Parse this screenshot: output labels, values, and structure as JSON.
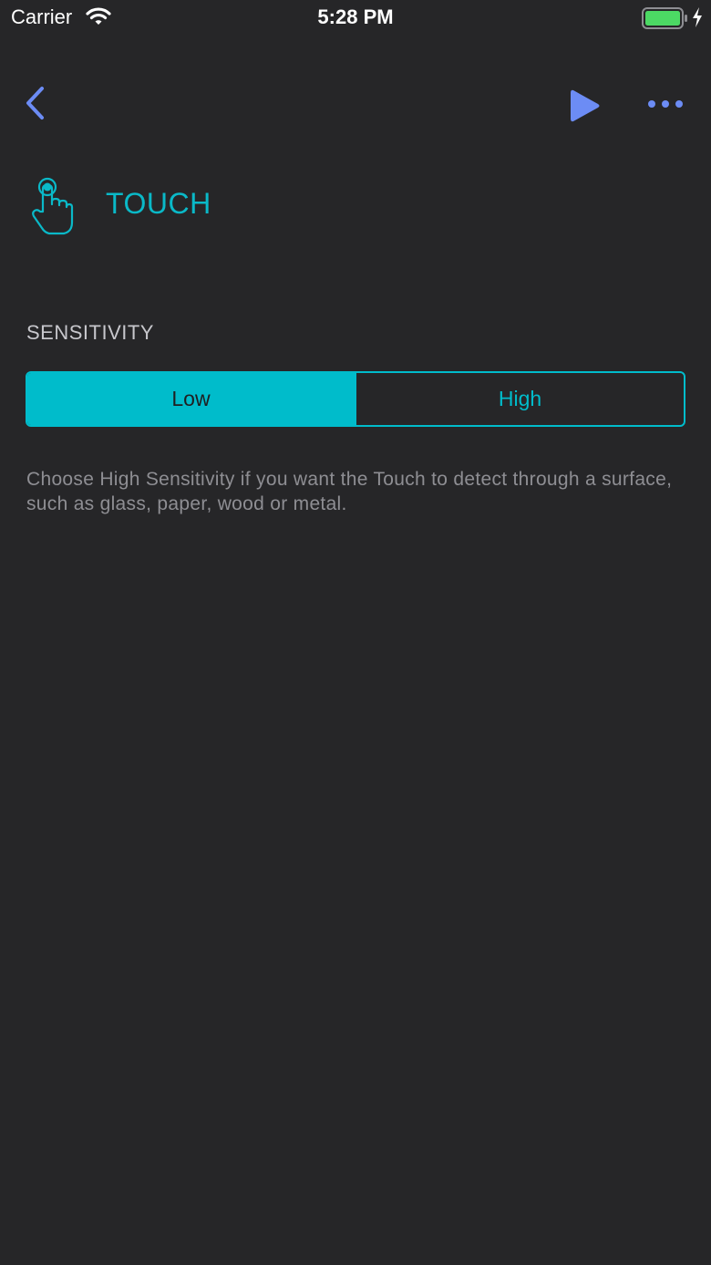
{
  "status_bar": {
    "carrier": "Carrier",
    "time": "5:28 PM",
    "battery_color": "#4cd964"
  },
  "nav": {
    "back_icon": "chevron-left-icon",
    "play_icon": "play-icon",
    "more_icon": "ellipsis-icon",
    "icon_color": "#6c8cf5"
  },
  "header": {
    "icon": "touch-hand-icon",
    "title": "TOUCH",
    "accent_color": "#0ab9c8"
  },
  "sensitivity": {
    "label": "SENSITIVITY",
    "options": [
      "Low",
      "High"
    ],
    "selected": "Low",
    "description": "Choose High Sensitivity if you want the Touch to detect through a surface, such as glass, paper, wood or metal."
  }
}
